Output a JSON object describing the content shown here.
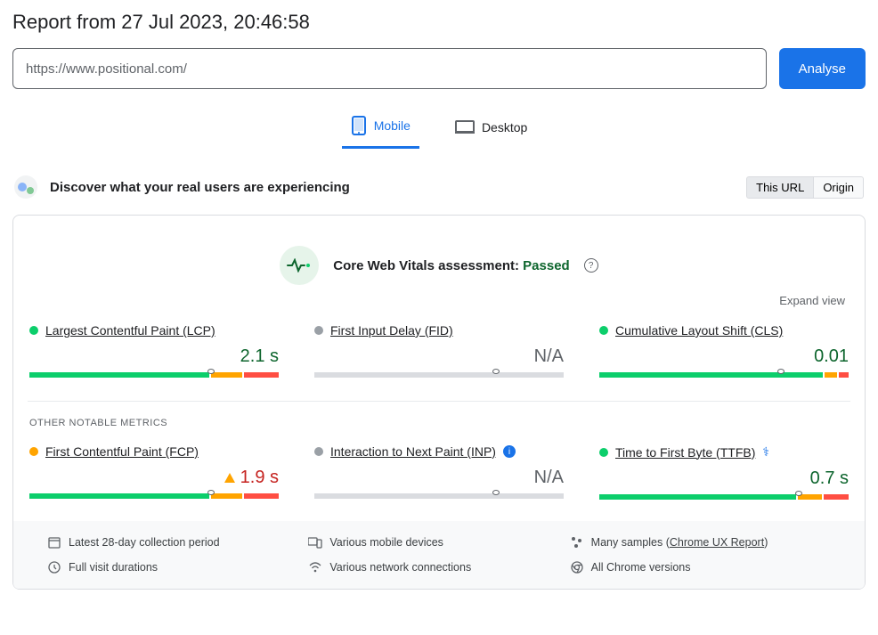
{
  "page_title": "Report from 27 Jul 2023, 20:46:58",
  "url_input": {
    "value": "https://www.positional.com/"
  },
  "analyse_label": "Analyse",
  "tabs": {
    "mobile": "Mobile",
    "desktop": "Desktop",
    "active": "mobile"
  },
  "discover_text": "Discover what your real users are experiencing",
  "scope": {
    "url": "This URL",
    "origin": "Origin"
  },
  "assessment": {
    "prefix": "Core Web Vitals assessment: ",
    "status": "Passed"
  },
  "expand_label": "Expand view",
  "metrics_core": [
    {
      "name": "Largest Contentful Paint (LCP)",
      "value": "2.1 s",
      "status": "green",
      "bar": {
        "g": 73,
        "o": 13,
        "r": 14,
        "gray": false,
        "marker": 73
      }
    },
    {
      "name": "First Input Delay (FID)",
      "value": "N/A",
      "status": "gray",
      "bar": {
        "gray": true,
        "marker": 73
      }
    },
    {
      "name": "Cumulative Layout Shift (CLS)",
      "value": "0.01",
      "status": "green",
      "bar": {
        "g": 91,
        "o": 5,
        "r": 4,
        "gray": false,
        "marker": 73
      }
    }
  ],
  "other_label": "OTHER NOTABLE METRICS",
  "metrics_other": [
    {
      "name": "First Contentful Paint (FCP)",
      "value": "1.9 s",
      "status": "orange",
      "warn": true,
      "bar": {
        "g": 73,
        "o": 13,
        "r": 14,
        "gray": false,
        "marker": 73
      }
    },
    {
      "name": "Interaction to Next Paint (INP)",
      "value": "N/A",
      "status": "gray",
      "info": true,
      "bar": {
        "gray": true,
        "marker": 73
      }
    },
    {
      "name": "Time to First Byte (TTFB)",
      "value": "0.7 s",
      "status": "green",
      "flask": true,
      "bar": {
        "g": 80,
        "o": 10,
        "r": 10,
        "gray": false,
        "marker": 80
      }
    }
  ],
  "footer": {
    "period": "Latest 28-day collection period",
    "devices": "Various mobile devices",
    "samples_prefix": "Many samples (",
    "samples_link": "Chrome UX Report",
    "samples_suffix": ")",
    "visit": "Full visit durations",
    "network": "Various network connections",
    "chrome": "All Chrome versions"
  },
  "colors": {
    "green": "#0cce6b",
    "orange": "#ffa400",
    "red": "#ff4e42",
    "gray": "#dadce0"
  }
}
